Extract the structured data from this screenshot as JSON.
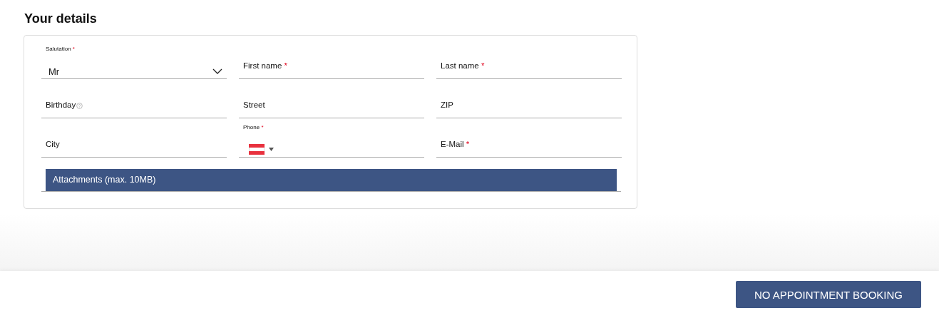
{
  "heading": "Your details",
  "fields": [
    {
      "kind": "select",
      "label": "Salutation",
      "required_mark": "*",
      "value": "Mr"
    },
    {
      "kind": "text",
      "label": "First name",
      "required_mark": "*"
    },
    {
      "kind": "text",
      "label": "Last name",
      "required_mark": "*"
    },
    {
      "kind": "text",
      "label": "Birthday",
      "help": true
    },
    {
      "kind": "text",
      "label": "Street"
    },
    {
      "kind": "text",
      "label": "ZIP"
    },
    {
      "kind": "text",
      "label": "City"
    },
    {
      "kind": "phone",
      "label": "Phone",
      "required_mark": "*"
    },
    {
      "kind": "text",
      "label": "E-Mail",
      "required_mark": "*"
    }
  ],
  "attachments": {
    "title": "Attachments (max. 10MB)"
  },
  "footer": {
    "button": "NO APPOINTMENT BOOKING"
  }
}
